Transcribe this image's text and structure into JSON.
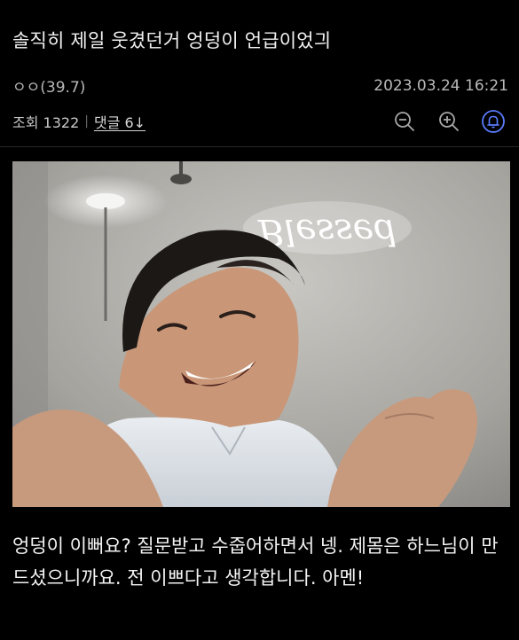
{
  "post": {
    "title": "솔직히 제일 웃겼던거 엉덩이 언급이었긔",
    "author": "ㅇㅇ(39.7)",
    "datetime": "2023.03.24 16:21",
    "views_label": "조회 1322",
    "separator": "|",
    "comments_label": "댓글 6↓",
    "image_sign_text": "Blessed",
    "body": "엉덩이 이뻐요? 질문받고 수줍어하면서 넹. 제몸은 하느님이 만드셨으니까요. 전 이쁘다고 생각합니다. 아멘!"
  },
  "toolbar": {
    "icons": [
      "zoom-out-icon",
      "zoom-in-icon",
      "notification-bell-icon"
    ],
    "accent_color": "#5a7dff"
  }
}
